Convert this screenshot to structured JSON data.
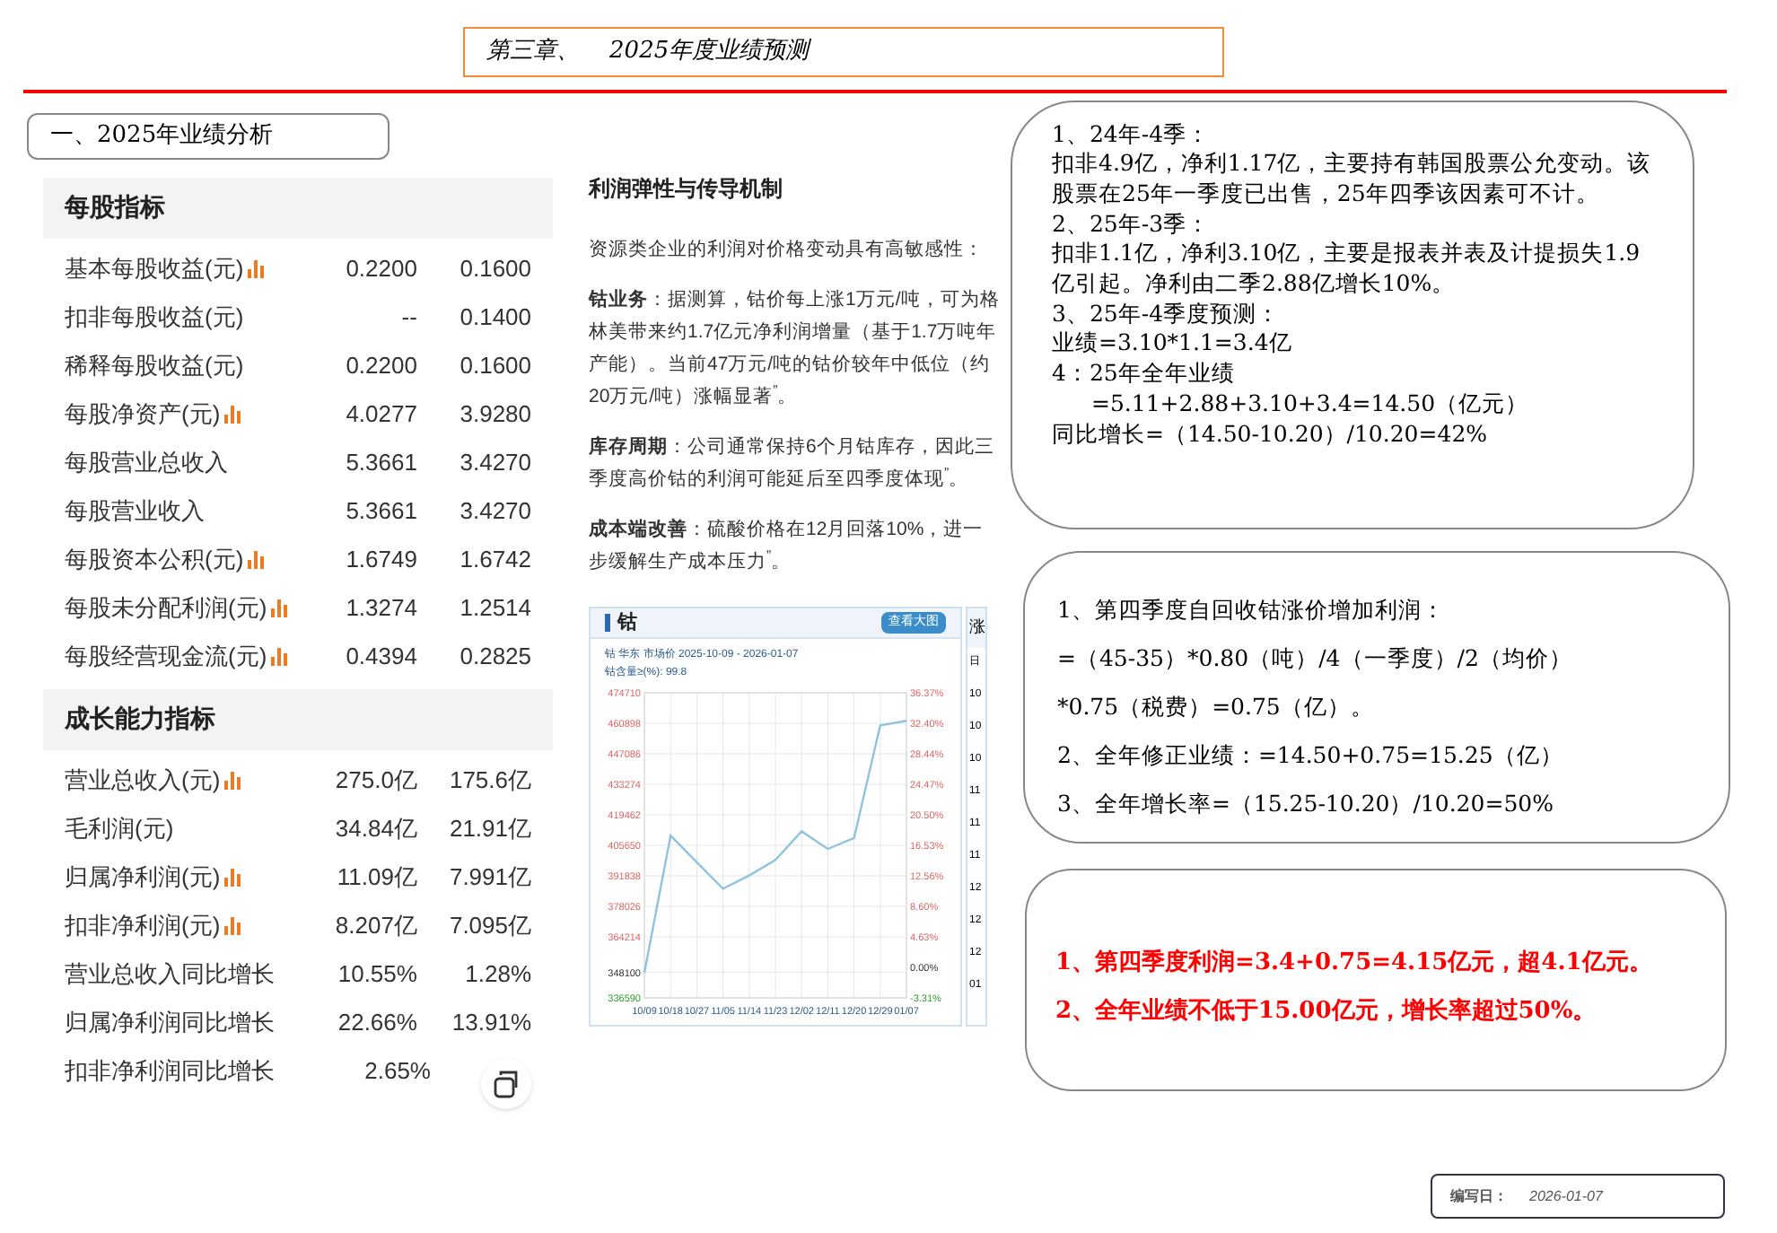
{
  "header": {
    "chapter_title": "第三章、    2025年度业绩预测"
  },
  "section_title": "一、2025年业绩分析",
  "indicator_table": {
    "sections": [
      {
        "title": "每股指标",
        "rows": [
          {
            "label": "基本每股收益(元)",
            "has_chart": true,
            "values": [
              "0.2200",
              "0.1600"
            ]
          },
          {
            "label": "扣非每股收益(元)",
            "has_chart": false,
            "values": [
              "--",
              "0.1400"
            ]
          },
          {
            "label": "稀释每股收益(元)",
            "has_chart": false,
            "values": [
              "0.2200",
              "0.1600"
            ]
          },
          {
            "label": "每股净资产(元)",
            "has_chart": true,
            "values": [
              "4.0277",
              "3.9280"
            ]
          },
          {
            "label": "每股营业总收入",
            "has_chart": false,
            "values": [
              "5.3661",
              "3.4270"
            ]
          },
          {
            "label": "每股营业收入",
            "has_chart": false,
            "values": [
              "5.3661",
              "3.4270"
            ]
          },
          {
            "label": "每股资本公积(元)",
            "has_chart": true,
            "values": [
              "1.6749",
              "1.6742"
            ]
          },
          {
            "label": "每股未分配利润(元)",
            "has_chart": true,
            "values": [
              "1.3274",
              "1.2514"
            ]
          },
          {
            "label": "每股经营现金流(元)",
            "has_chart": true,
            "values": [
              "0.4394",
              "0.2825"
            ]
          }
        ]
      },
      {
        "title": "成长能力指标",
        "rows": [
          {
            "label": "营业总收入(元)",
            "has_chart": true,
            "values": [
              "275.0亿",
              "175.6亿"
            ]
          },
          {
            "label": "毛利润(元)",
            "has_chart": false,
            "values": [
              "34.84亿",
              "21.91亿"
            ]
          },
          {
            "label": "归属净利润(元)",
            "has_chart": true,
            "values": [
              "11.09亿",
              "7.991亿"
            ]
          },
          {
            "label": "扣非净利润(元)",
            "has_chart": true,
            "values": [
              "8.207亿",
              "7.095亿"
            ]
          },
          {
            "label": "营业总收入同比增长",
            "has_chart": false,
            "values": [
              "10.55%",
              "1.28%"
            ]
          },
          {
            "label": "归属净利润同比增长",
            "has_chart": false,
            "values": [
              "22.66%",
              "13.91%"
            ]
          },
          {
            "label": "扣非净利润同比增长",
            "has_chart": false,
            "values": [
              "2.65%"
            ]
          }
        ]
      }
    ]
  },
  "analysis": {
    "title": "利润弹性与传导机制",
    "paragraphs": [
      "资源类企业的利润对价格变动具有高敏感性：",
      "**钴业务**：据测算，钴价每上涨1万元/吨，可为格林美带来约1.7亿元净利润增量（基于1.7万吨年产能）。当前47万元/吨的钴价较年中低位（约20万元/吨）涨幅显著$^{”}$。",
      "**库存周期**：公司通常保持6个月钴库存，因此三季度高价钴的利润可能延后至四季度体现$^{”}$。",
      "**成本端改善**：硫酸价格在12月回落10%，进一步缓解生产成本压力$^{”}$。"
    ]
  },
  "price_chart": {
    "enlarge_button": "查看大图",
    "subtitle": "钴 华东 市场价 2025-10-09 - 2026-01-07",
    "spec": "钴含量≥(%): 99.8",
    "right_axis_labels": [
      "36.37%",
      "32.40%",
      "28.44%",
      "24.47%",
      "20.50%",
      "16.53%",
      "12.56%",
      "8.60%",
      "4.63%",
      "0.00%",
      "-3.31%"
    ],
    "chart_data": {
      "type": "line",
      "grid": true,
      "categories": [
        "10/09",
        "10/18",
        "10/27",
        "11/05",
        "11/14",
        "11/23",
        "12/02",
        "12/11",
        "12/20",
        "12/29",
        "01/07"
      ],
      "series": [
        {
          "name": "钴",
          "color": "#8fc3e0",
          "values": [
            348000,
            410000,
            398000,
            386000,
            392000,
            399000,
            412000,
            404000,
            409000,
            460000,
            462000
          ]
        }
      ],
      "ylim": [
        336590,
        474710
      ],
      "yticks": [
        336590,
        348100,
        364214,
        378026,
        391838,
        405650,
        419462,
        433274,
        447086,
        460898,
        474710
      ]
    }
  },
  "side_panel": {
    "title": "涨",
    "items": [
      "日",
      "10",
      "10",
      "10",
      "11",
      "11",
      "11",
      "12",
      "12",
      "12",
      "01"
    ]
  },
  "notes": [
    {
      "kind": "plain",
      "lines": [
        {
          "text": "1、24年-4季：",
          "indent": false
        },
        {
          "text": "扣非4.9亿，净利1.17亿，主要持有韩国股票公允变动。该股票在25年一季度已出售，25年四季该因素可不计。",
          "indent": false
        },
        {
          "text": "2、25年-3季：",
          "indent": false
        },
        {
          "text": "扣非1.1亿，净利3.10亿，主要是报表并表及计提损失1.9亿引起。净利由二季2.88亿增长10%。",
          "indent": false
        },
        {
          "text": "3、25年-4季度预测：",
          "indent": false
        },
        {
          "text": "业绩=3.10*1.1=3.4亿",
          "indent": false
        },
        {
          "text": "4：25年全年业绩",
          "indent": false
        },
        {
          "text": "=5.11+2.88+3.10+3.4=14.50（亿元）",
          "indent": true
        },
        {
          "text": "同比增长=（14.50-10.20）/10.20=42%",
          "indent": false
        }
      ]
    },
    {
      "kind": "spaced",
      "lines": [
        {
          "text": "1、第四季度自回收钴涨价增加利润：",
          "indent": false
        },
        {
          "text": "=（45-35）*0.80（吨）/4（一季度）/2（均价）",
          "indent": false
        },
        {
          "text": "*0.75（税费）=0.75（亿）。",
          "indent": false
        },
        {
          "text": "2、全年修正业绩：=14.50+0.75=15.25（亿）",
          "indent": false
        },
        {
          "text": "3、全年增长率=（15.25-10.20）/10.20=50%",
          "indent": false
        }
      ]
    },
    {
      "kind": "conclusion",
      "lines": [
        {
          "text": "1、第四季度利润=3.4+0.75=4.15亿元，超4.1亿元。",
          "indent": false
        },
        {
          "text": "2、全年业绩不低于15.00亿元，增长率超过50%。",
          "indent": false
        }
      ]
    }
  ],
  "footer": {
    "label": "编写日：",
    "date": "2026-01-07"
  }
}
